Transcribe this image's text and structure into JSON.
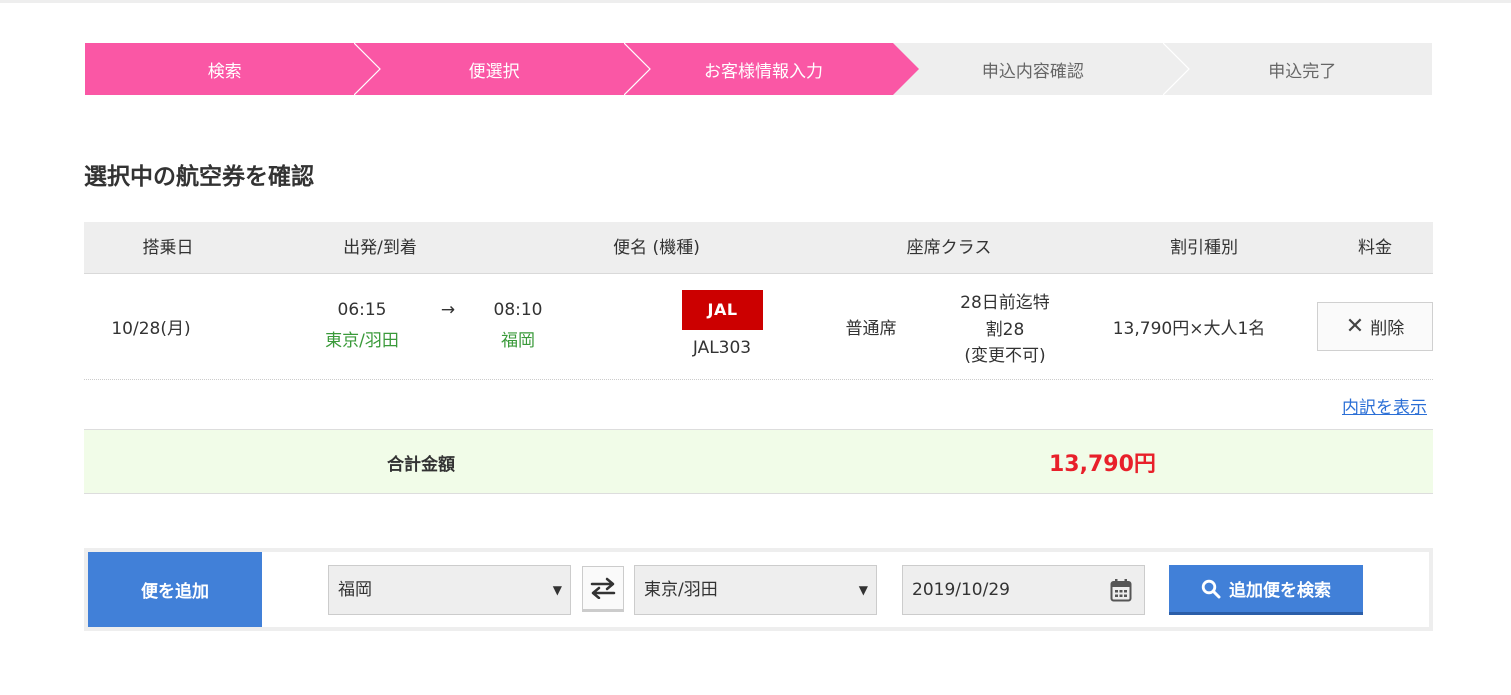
{
  "stepper": {
    "steps": [
      {
        "label": "検索",
        "state": "active"
      },
      {
        "label": "便選択",
        "state": "active"
      },
      {
        "label": "お客様情報入力",
        "state": "active"
      },
      {
        "label": "申込内容確認",
        "state": "pending"
      },
      {
        "label": "申込完了",
        "state": "pending"
      }
    ]
  },
  "section_title": "選択中の航空券を確認",
  "table": {
    "headers": {
      "date": "搭乗日",
      "dep_arr": "出発/到着",
      "flight": "便名 (機種)",
      "seat_class": "座席クラス",
      "discount": "割引種別",
      "fare": "料金"
    },
    "row": {
      "date": "10/28(月)",
      "dep_time": "06:15",
      "dep_airport": "東京/羽田",
      "arrow": "→",
      "arr_time": "08:10",
      "arr_airport": "福岡",
      "airline_logo": "JAL",
      "flight_no": "JAL303",
      "seat_class": "普通席",
      "discount_line1": "28日前迄特",
      "discount_line2": "割28",
      "discount_line3": "(変更不可)",
      "fare": "13,790円×大人1名",
      "delete_label": "削除"
    },
    "breakdown_link": "内訳を表示",
    "total_label": "合計金額",
    "total_amount": "13,790円"
  },
  "add_flight": {
    "label": "便を追加",
    "from_value": "福岡",
    "to_value": "東京/羽田",
    "date_value": "2019/10/29",
    "search_label": "追加便を検索"
  },
  "colors": {
    "step_active": "#fa57a5",
    "step_pending": "#eeeeee",
    "accent_blue": "#4180d8",
    "total_red": "#e8202a",
    "airport_green": "#3a9a3a",
    "jal_red": "#cc0000"
  },
  "icons": {
    "delete": "close-icon",
    "swap": "swap-arrows-icon",
    "calendar": "calendar-icon",
    "search": "search-icon"
  }
}
